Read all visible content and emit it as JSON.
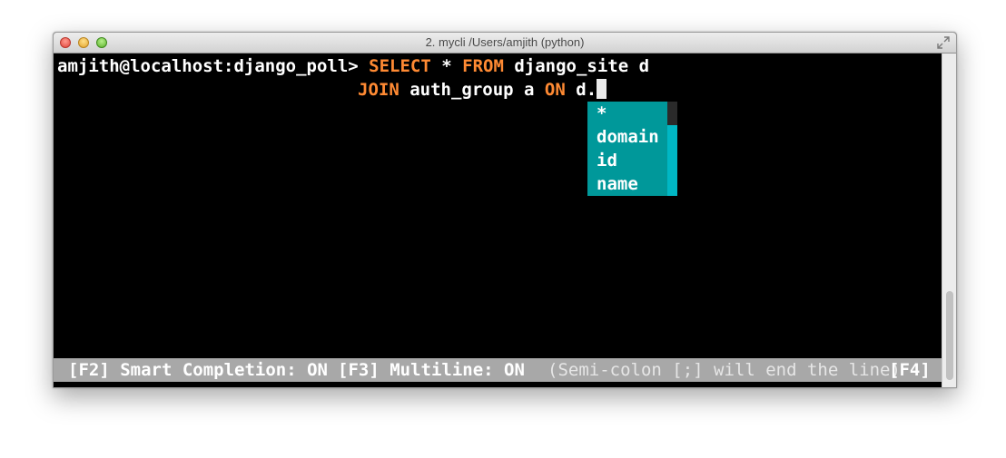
{
  "window": {
    "title": "2. mycli  /Users/amjith (python)"
  },
  "terminal": {
    "prompt": "amjith@localhost:django_poll> ",
    "line1": {
      "kw1": "SELECT",
      "t1": " * ",
      "kw2": "FROM",
      "t2": " django_site d"
    },
    "line2": {
      "kw1": "JOIN",
      "t1": " auth_group a ",
      "kw2": "ON",
      "t2": " d."
    }
  },
  "completion": {
    "items": [
      "*",
      "domain",
      "id",
      "name"
    ],
    "selected_index": 0
  },
  "toolbar": {
    "f2": "[F2] Smart Completion: ON",
    "f3": "[F3] Multiline: ON",
    "hint": "(Semi-colon [;] will end the line)",
    "f4": "[F4]"
  },
  "colors": {
    "keyword": "#ff8a33",
    "completion_bg": "#00989a",
    "toolbar_bg": "#a8a8a8"
  }
}
